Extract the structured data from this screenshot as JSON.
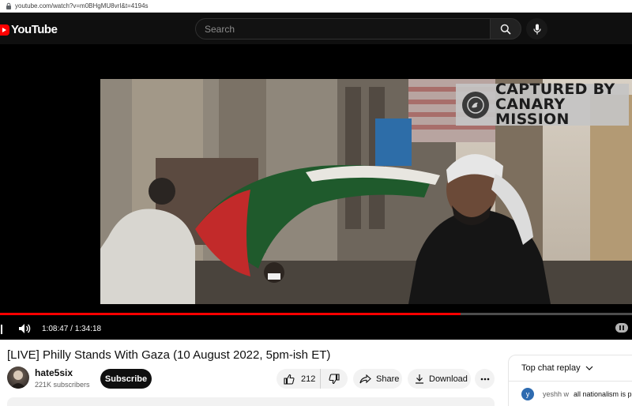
{
  "browser": {
    "url": "youtube.com/watch?v=m0BHgMU8vrI&t=4194s"
  },
  "header": {
    "logo_text": "YouTube",
    "search_placeholder": "Search"
  },
  "player": {
    "watermark_line1": "CAPTURED BY",
    "watermark_line2": "CANARY MISSION",
    "current_time": "1:08:47",
    "duration": "1:34:18",
    "time_display": "1:08:47 / 1:34:18",
    "progress_fraction": 0.729
  },
  "video_info": {
    "title": "[LIVE] Philly Stands With Gaza (10 August 2022, 5pm-ish ET)",
    "channel_name": "hate5six",
    "subscribers": "221K subscribers",
    "subscribe_label": "Subscribe",
    "like_count": "212",
    "share_label": "Share",
    "download_label": "Download"
  },
  "chat": {
    "header": "Top chat replay",
    "messages": [
      {
        "avatar_letter": "y",
        "author": "yeshh w",
        "text": "all nationalism is pe"
      }
    ]
  },
  "colors": {
    "brand_red": "#ff0000",
    "header_bg": "#0f0f0f",
    "pill_bg": "#f2f2f2"
  },
  "icons": [
    "lock-icon",
    "youtube-logo-icon",
    "search-icon",
    "mic-icon",
    "volume-icon",
    "autoplay-toggle-icon",
    "thumbs-up-icon",
    "thumbs-down-icon",
    "share-icon",
    "download-icon",
    "more-icon",
    "chevron-down-icon"
  ]
}
